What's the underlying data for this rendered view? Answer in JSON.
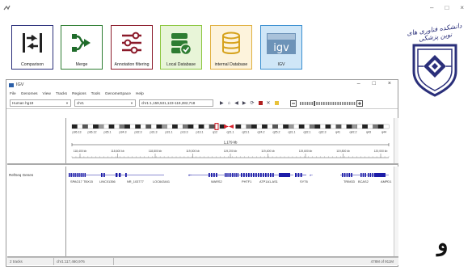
{
  "toolbar": {
    "comparison_label": "Comparison",
    "merge_label": "Merge",
    "annotation_label": "Annotation filtering",
    "local_db_label": "Local Database",
    "internal_db_label": "internal Database",
    "igv_label": "IGV",
    "igv_logo_text": "igv"
  },
  "logo": {
    "text": "دانشکده فناوری های نوین پزشکی"
  },
  "bottom_letter": "و",
  "igv": {
    "title": "IGV",
    "menu": [
      "File",
      "Genomes",
      "View",
      "Tracks",
      "Regions",
      "Tools",
      "GenomeSpace",
      "Help"
    ],
    "genome": "Human hg19",
    "chromosome": "chr1",
    "locus": "chr1:1,159,531,123-119,282,718",
    "ideogram_bands": [
      "p36.13",
      "p36.12",
      "p35.1",
      "p34.3",
      "p32.3",
      "p31.3",
      "p31.1",
      "p13.3",
      "p13.1",
      "q12",
      "q21.1",
      "q23.1",
      "q24.2",
      "q25.2",
      "q31.1",
      "q32.1",
      "q32.3",
      "q41",
      "q42.2",
      "q43",
      "q44"
    ],
    "region_size": "1,179 kb",
    "ruler_ticks": [
      "118,400 kb",
      "118,600 kb",
      "118,800 kb",
      "119,000 kb",
      "119,200 kb",
      "119,400 kb",
      "119,600 kb",
      "119,800 kb",
      "120,000 kb"
    ],
    "track_name": "RefSeq Genes",
    "genes": [
      "SPAG17",
      "TBX15",
      "LINC01356",
      "NR_103777",
      "LOC643441",
      "WARS2",
      "PHTF1",
      "ATP1A1-AS1",
      "SYT6",
      "TRIM33",
      "BCAS2",
      "AMPD1"
    ],
    "status_left": "2 tracks",
    "status_mid": "chr1:117,460,976",
    "status_right": "478M of 911M"
  },
  "colors": {
    "accent_blue": "#2b2f8a",
    "gene_blue": "#1c1ca8",
    "centromere_red": "#d9232d"
  }
}
